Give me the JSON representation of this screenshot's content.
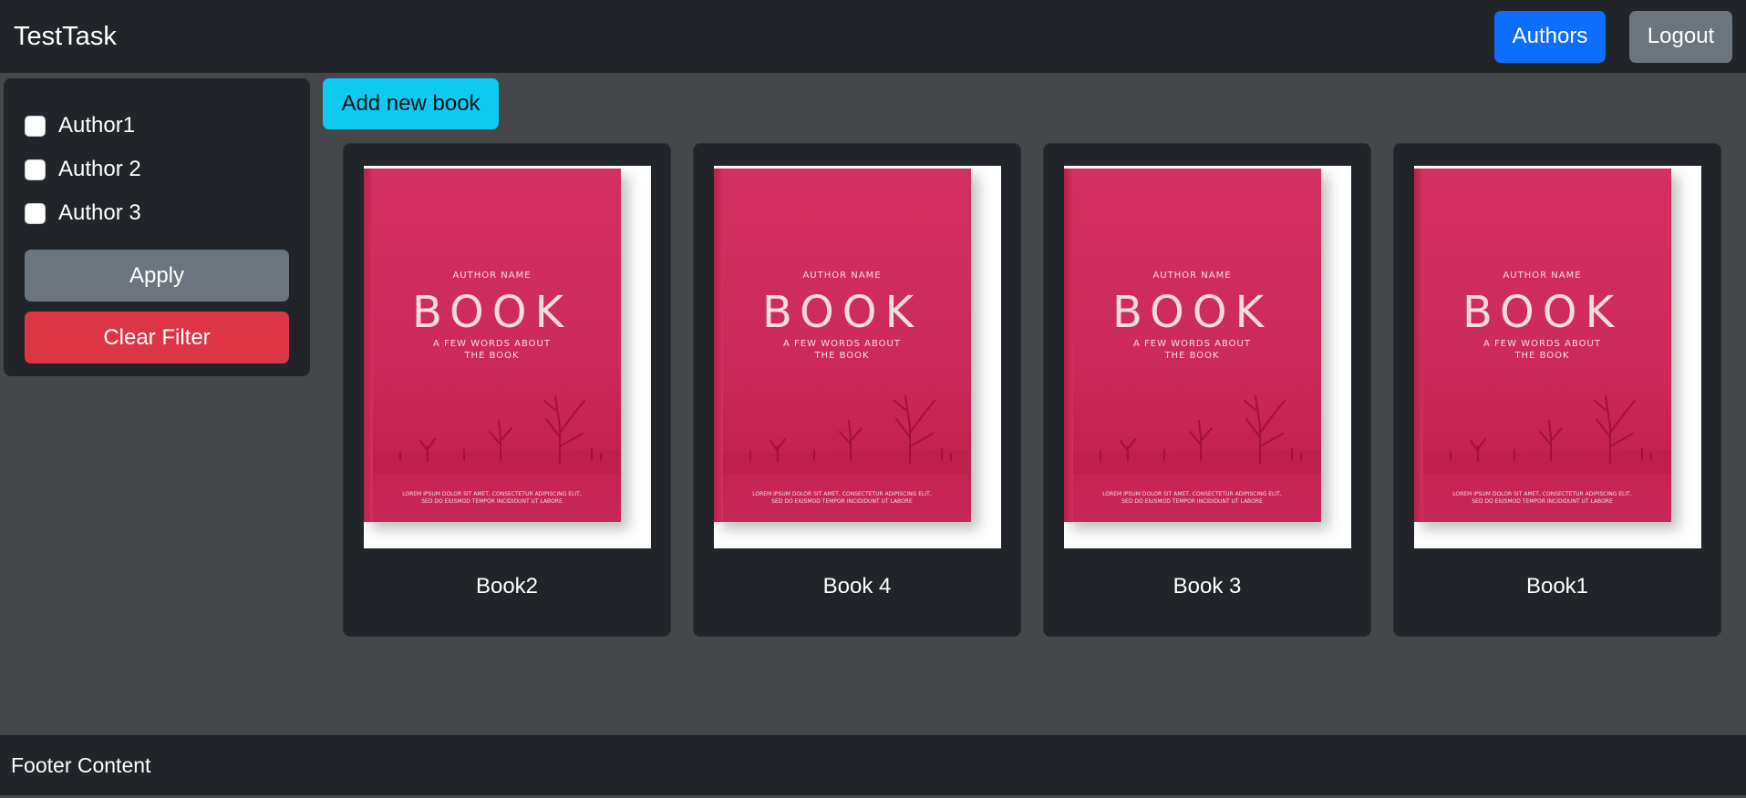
{
  "header": {
    "brand": "TestTask",
    "authors_label": "Authors",
    "logout_label": "Logout"
  },
  "sidebar": {
    "filters": [
      {
        "label": "Author1",
        "checked": false
      },
      {
        "label": "Author 2",
        "checked": false
      },
      {
        "label": "Author 3",
        "checked": false
      }
    ],
    "apply_label": "Apply",
    "clear_label": "Clear Filter"
  },
  "main": {
    "add_label": "Add new book",
    "books": [
      {
        "title": "Book2"
      },
      {
        "title": "Book 4"
      },
      {
        "title": "Book 3"
      },
      {
        "title": "Book1"
      }
    ],
    "cover": {
      "author": "AUTHOR NAME",
      "title": "BOOK",
      "subtitle_line1": "A FEW WORDS ABOUT",
      "subtitle_line2": "THE BOOK",
      "foot_line1": "LOREM IPSUM DOLOR SIT AMET, CONSECTETUR ADIPISCING ELIT,",
      "foot_line2": "SED DO EIUSMOD TEMPOR INCIDIDUNT UT LABORE"
    }
  },
  "footer": {
    "text": "Footer Content"
  },
  "colors": {
    "page_bg": "#46474a",
    "panel_bg": "#212529",
    "primary": "#0d6efd",
    "secondary": "#6c757d",
    "danger": "#dc3545",
    "info": "#0dcaf0",
    "cover_pink": "#d42f62"
  }
}
